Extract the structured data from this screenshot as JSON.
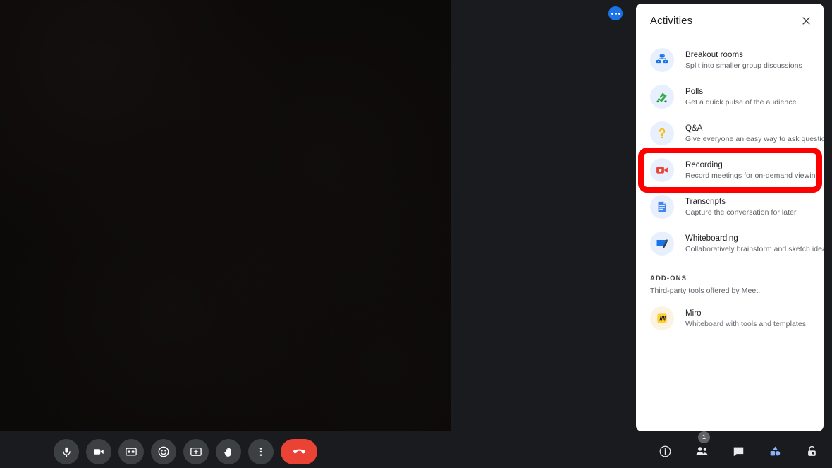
{
  "stage": {
    "video_tile_name": "self-view video tile"
  },
  "floating_badge": {
    "icon": "three-dots-icon"
  },
  "panel": {
    "title": "Activities",
    "close_label": "✕",
    "items": [
      {
        "icon": "breakout-rooms-icon",
        "title": "Breakout rooms",
        "desc": "Split into smaller group discussions"
      },
      {
        "icon": "polls-icon",
        "title": "Polls",
        "desc": "Get a quick pulse of the audience"
      },
      {
        "icon": "qa-icon",
        "title": "Q&A",
        "desc": "Give everyone an easy way to ask questions"
      },
      {
        "icon": "recording-icon",
        "title": "Recording",
        "desc": "Record meetings for on-demand viewing"
      },
      {
        "icon": "transcripts-icon",
        "title": "Transcripts",
        "desc": "Capture the conversation for later"
      },
      {
        "icon": "whiteboarding-icon",
        "title": "Whiteboarding",
        "desc": "Collaboratively brainstorm and sketch ideas"
      }
    ],
    "addons": {
      "label": "ADD-ONS",
      "subtitle": "Third-party tools offered by Meet.",
      "items": [
        {
          "icon": "miro-icon",
          "title": "Miro",
          "desc": "Whiteboard with tools and templates"
        }
      ]
    }
  },
  "highlight": {
    "target": "Recording",
    "color": "#ff0000"
  },
  "controls": {
    "left": [
      {
        "icon": "microphone-icon",
        "name": "mute-toggle-button"
      },
      {
        "icon": "camera-icon",
        "name": "camera-toggle-button"
      },
      {
        "icon": "closed-captions-icon",
        "name": "captions-button"
      },
      {
        "icon": "emoji-icon",
        "name": "reactions-button"
      },
      {
        "icon": "present-screen-icon",
        "name": "present-now-button"
      },
      {
        "icon": "raise-hand-icon",
        "name": "raise-hand-button"
      },
      {
        "icon": "more-options-icon",
        "name": "more-options-button"
      },
      {
        "icon": "hangup-icon",
        "name": "leave-call-button"
      }
    ],
    "right": [
      {
        "icon": "info-icon",
        "name": "meeting-details-button",
        "badge": ""
      },
      {
        "icon": "people-icon",
        "name": "people-button",
        "badge": "1"
      },
      {
        "icon": "chat-icon",
        "name": "chat-button",
        "badge": ""
      },
      {
        "icon": "activities-icon",
        "name": "activities-button",
        "badge": ""
      },
      {
        "icon": "host-controls-lock-icon",
        "name": "host-controls-button",
        "badge": ""
      }
    ]
  },
  "colors": {
    "accent_blue": "#1a73e8",
    "hangup_red": "#ea4335",
    "highlight_red": "#ff0000",
    "panel_bg": "#ffffff",
    "page_bg": "#1a1b1e"
  }
}
